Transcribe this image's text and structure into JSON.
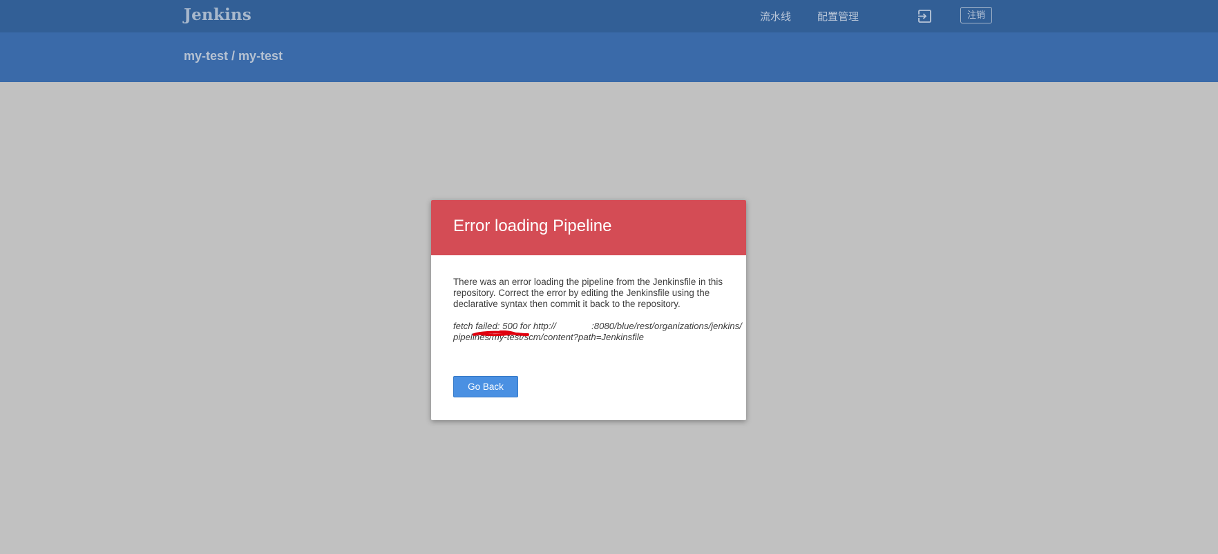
{
  "header": {
    "logo": "Jenkins",
    "nav": {
      "pipelines": "流水线",
      "administration": "配置管理"
    },
    "logout_label": "注销"
  },
  "breadcrumb": {
    "organization": "my-test",
    "separator": " / ",
    "pipeline": "my-test"
  },
  "modal": {
    "title": "Error loading Pipeline",
    "message": "There was an error loading the pipeline from the Jenkinsfile in this repository. Correct the error by editing the Jenkinsfile using the declarative syntax then commit it back to the repository.",
    "error_text": "fetch failed: 500 for http://              :8080/blue/rest/organizations/jenkins/pipelines/my-test/scm/content?path=Jenkinsfile",
    "go_back_label": "Go Back"
  },
  "colors": {
    "topbar": "#325f96",
    "subheader": "#3a6aa9",
    "backdrop": "#c1c1c1",
    "modal_header": "#d44c55",
    "button": "#4a90e2",
    "redaction": "#e0000f"
  },
  "icons": {
    "logout": "logout-icon"
  }
}
